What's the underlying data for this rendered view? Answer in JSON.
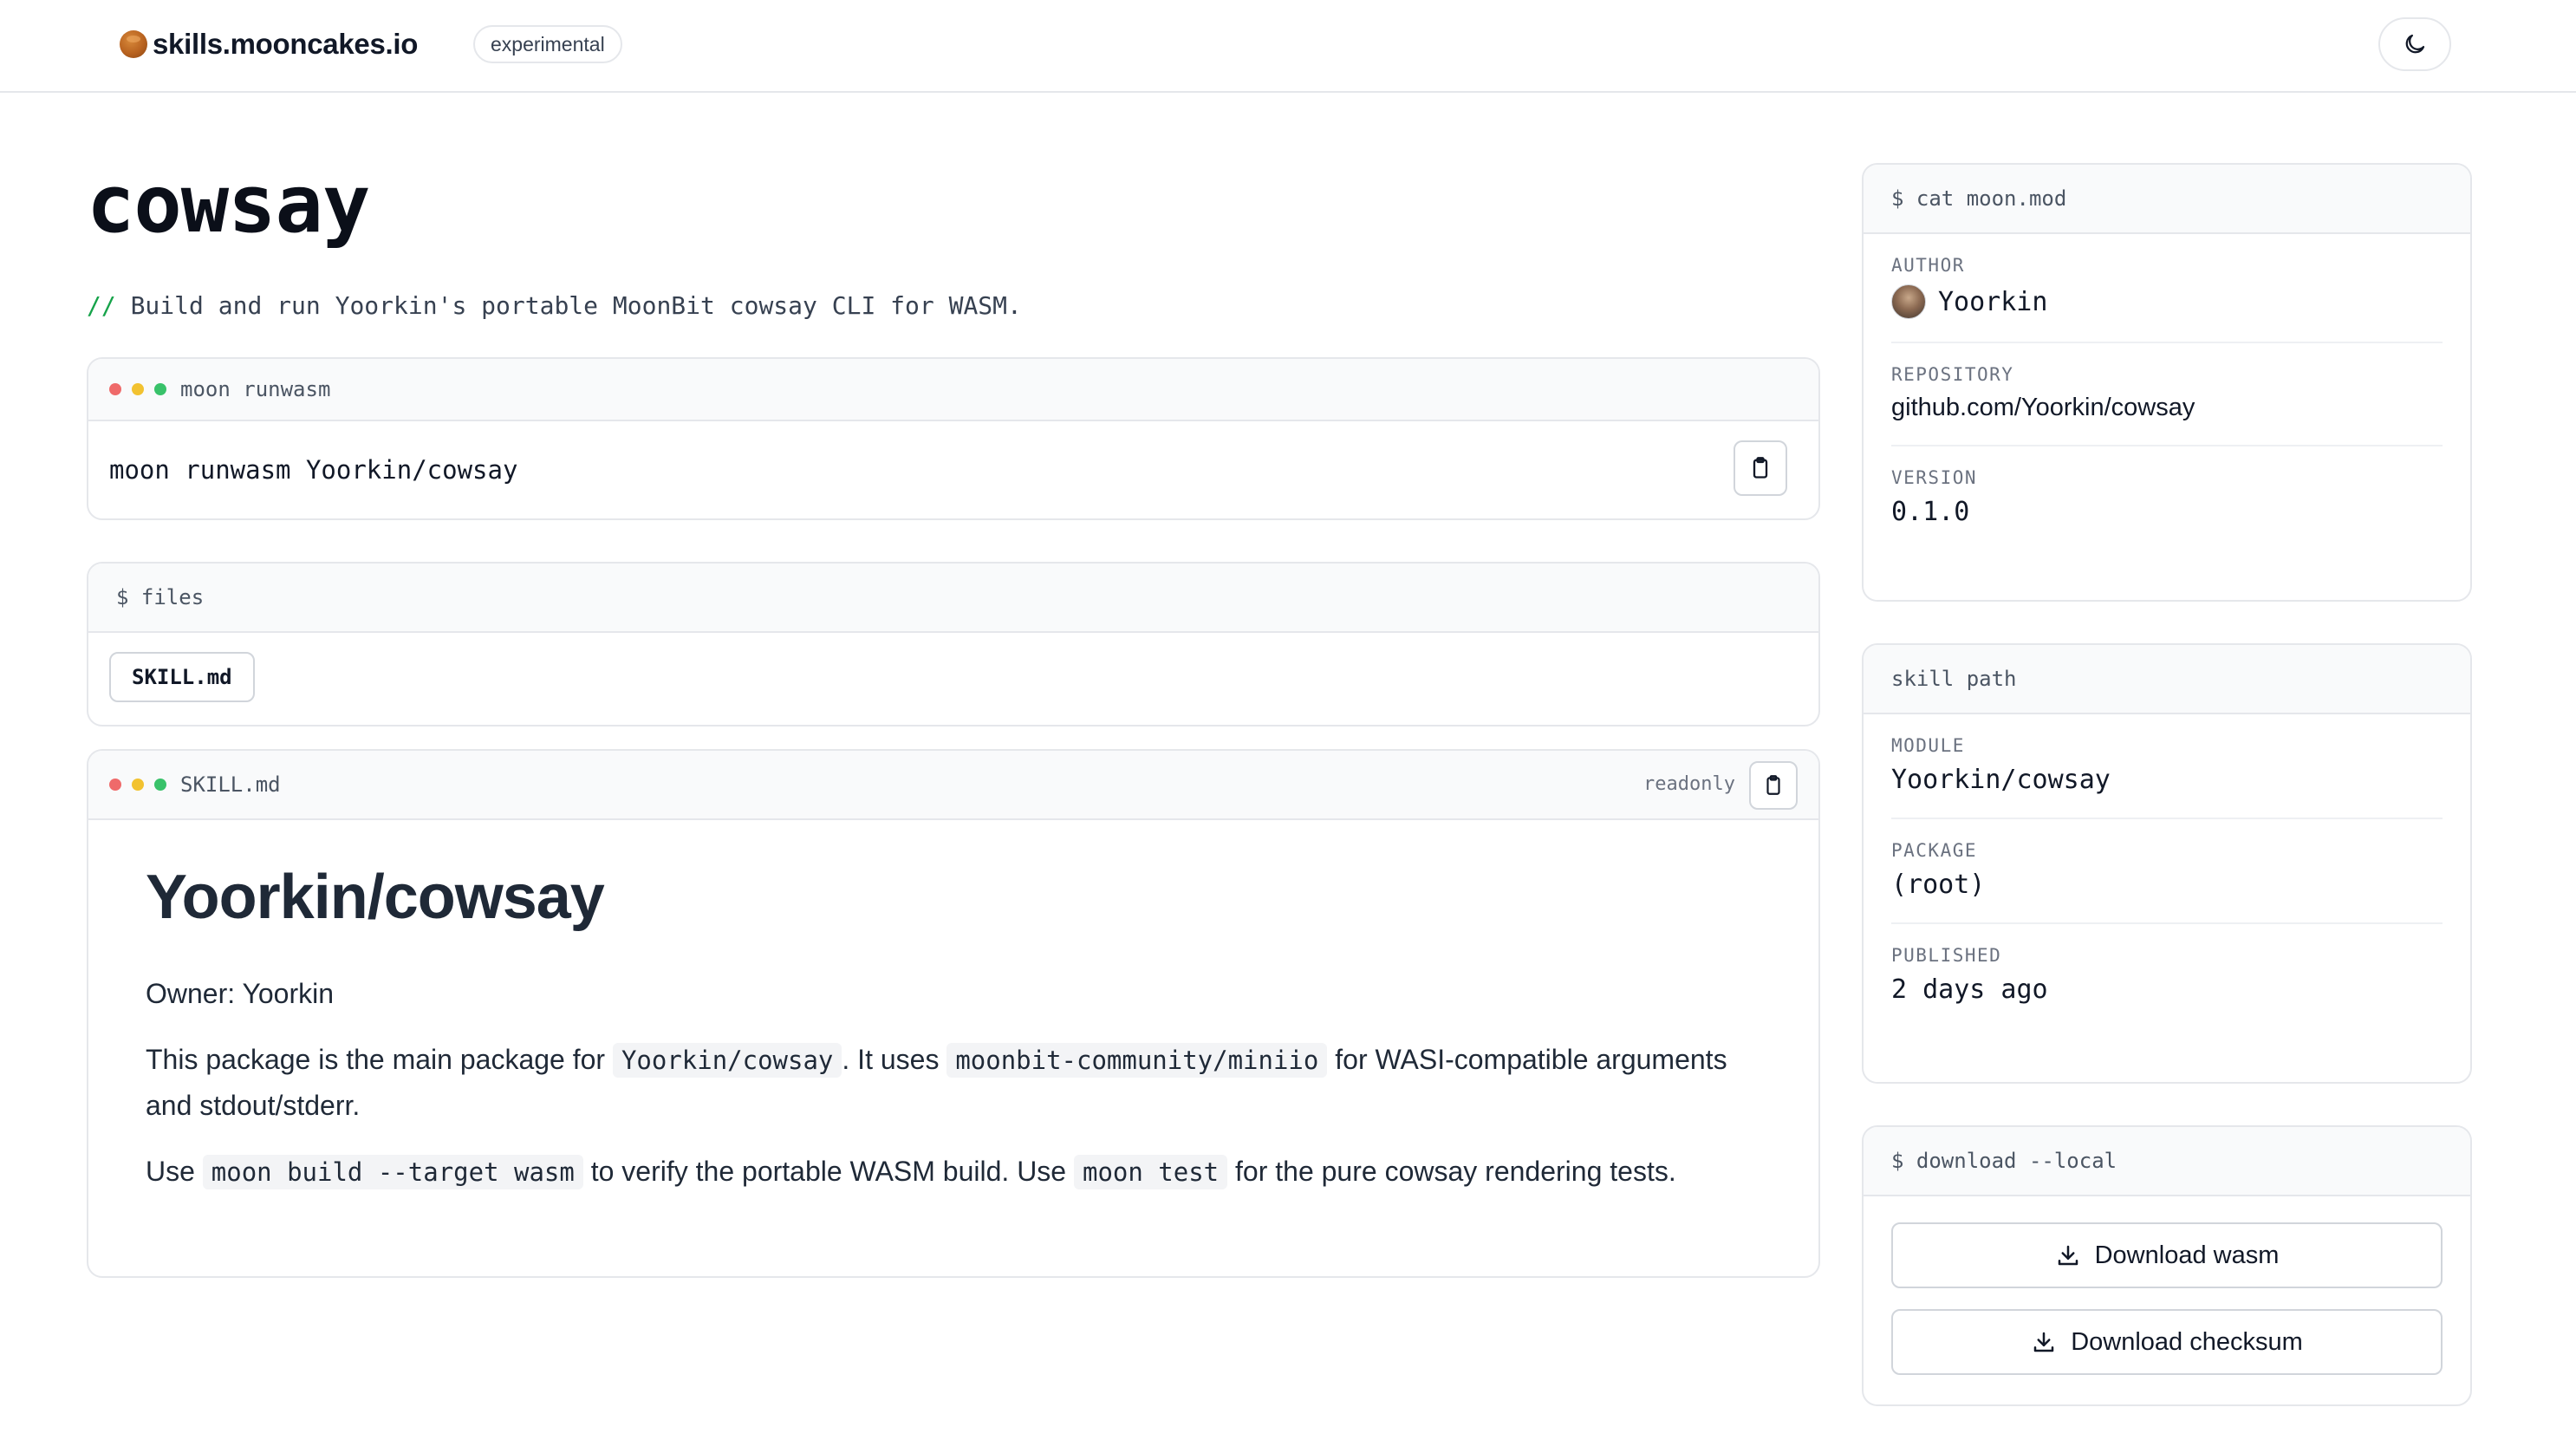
{
  "header": {
    "brand": "skills.mooncakes.io",
    "badge": "experimental"
  },
  "page": {
    "title": "cowsay",
    "subtitle_prefix": "//",
    "subtitle": "Build and run Yoorkin's portable MoonBit cowsay CLI for WASM."
  },
  "command_panel": {
    "header": "moon runwasm",
    "command": "moon runwasm Yoorkin/cowsay"
  },
  "files_panel": {
    "header": "$ files",
    "files": [
      "SKILL.md"
    ]
  },
  "doc_panel": {
    "header": "SKILL.md",
    "readonly_label": "readonly",
    "h1": "Yoorkin/cowsay",
    "owner_line": "Owner: Yoorkin",
    "p2_a": "This package is the main package for ",
    "p2_code1": "Yoorkin/cowsay",
    "p2_b": ". It uses ",
    "p2_code2": "moonbit-community/miniio",
    "p2_c": " for WASI-compatible arguments and stdout/stderr.",
    "p3_a": "Use ",
    "p3_code1": "moon build --target wasm",
    "p3_b": " to verify the portable WASM build. Use ",
    "p3_code2": "moon test",
    "p3_c": " for the pure cowsay rendering tests."
  },
  "meta_panel": {
    "header": "$ cat moon.mod",
    "author_label": "AUTHOR",
    "author": "Yoorkin",
    "repository_label": "REPOSITORY",
    "repository": "github.com/Yoorkin/cowsay",
    "version_label": "VERSION",
    "version": "0.1.0"
  },
  "path_panel": {
    "header": "skill path",
    "module_label": "MODULE",
    "module": "Yoorkin/cowsay",
    "package_label": "PACKAGE",
    "package": "(root)",
    "published_label": "PUBLISHED",
    "published": "2 days ago"
  },
  "download_panel": {
    "header": "$ download --local",
    "wasm_label": "Download wasm",
    "checksum_label": "Download checksum"
  },
  "icons": {
    "theme": "moon-icon",
    "copy": "clipboard-icon",
    "download": "download-icon",
    "logo": "mooncake-icon"
  }
}
